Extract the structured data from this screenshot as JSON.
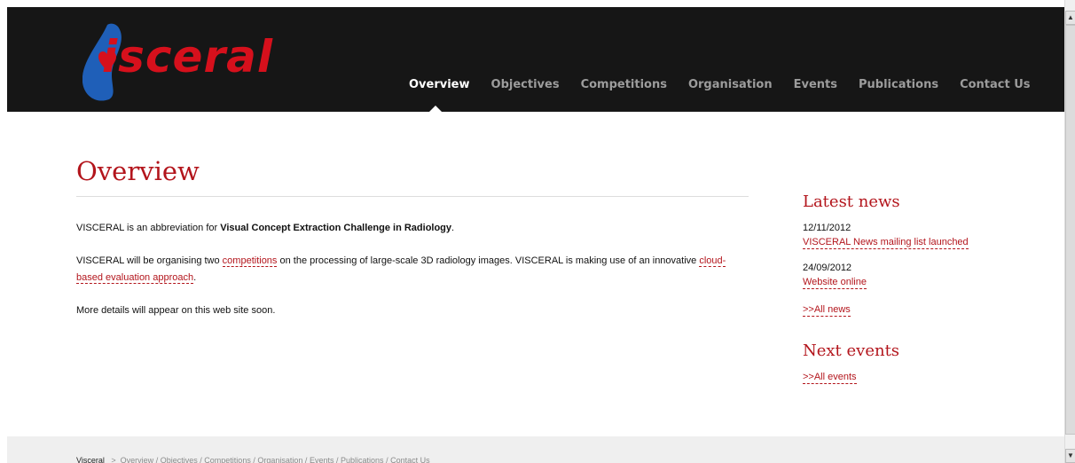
{
  "brand": {
    "logo_text": "isceral",
    "colors": {
      "accent": "#b3151c",
      "header_bg": "#161616",
      "logo_blue": "#1f5fb8"
    }
  },
  "nav": {
    "items": [
      {
        "label": "Overview",
        "active": true
      },
      {
        "label": "Objectives"
      },
      {
        "label": "Competitions"
      },
      {
        "label": "Organisation"
      },
      {
        "label": "Events"
      },
      {
        "label": "Publications"
      },
      {
        "label": "Contact Us"
      }
    ]
  },
  "main": {
    "title": "Overview",
    "p1": {
      "before": "VISCERAL is an abbreviation for ",
      "bold": "Visual Concept Extraction Challenge in Radiology",
      "after": "."
    },
    "p2": {
      "before": "VISCERAL will be organising two ",
      "link1": "competitions",
      "middle": " on the processing of large-scale 3D radiology images. VISCERAL is making use of an innovative ",
      "link2": "cloud-based evaluation approach",
      "after": "."
    },
    "p3": "More details will appear on this web site soon."
  },
  "sidebar": {
    "latest_news_heading": "Latest news",
    "news": [
      {
        "date": "12/11/2012",
        "title": "VISCERAL News mailing list launched"
      },
      {
        "date": "24/09/2012",
        "title": "Website online"
      }
    ],
    "all_news": ">>All news",
    "next_events_heading": "Next events",
    "all_events": ">>All events"
  },
  "footer": {
    "brand": "Visceral",
    "separator": ">",
    "links": [
      "Overview",
      "Objectives",
      "Competitions",
      "Organisation",
      "Events",
      "Publications",
      "Contact Us"
    ],
    "link_separator": "/"
  },
  "scrollbar": {
    "up_icon": "▲",
    "down_icon": "▼"
  }
}
